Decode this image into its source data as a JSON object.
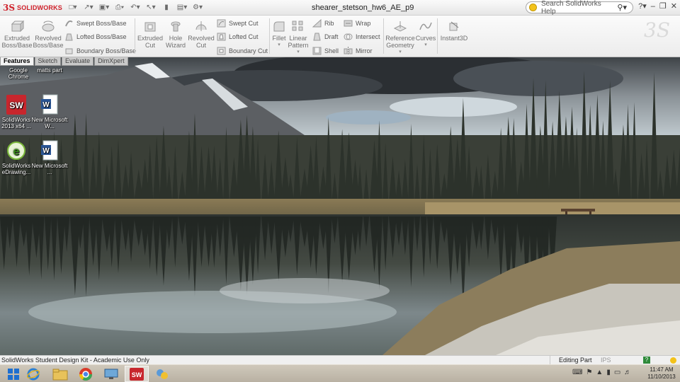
{
  "app": {
    "brand": "SOLIDWORKS",
    "document_title": "shearer_stetson_hw6_AE_p9"
  },
  "help_search": {
    "placeholder": "Search SolidWorks Help"
  },
  "toolbar": {
    "extruded_boss": "Extruded Boss/Base",
    "revolved_boss": "Revolved Boss/Base",
    "swept_boss": "Swept Boss/Base",
    "lofted_boss": "Lofted Boss/Base",
    "boundary_boss": "Boundary Boss/Base",
    "extruded_cut": "Extruded Cut",
    "hole_wizard": "Hole Wizard",
    "revolved_cut": "Revolved Cut",
    "swept_cut": "Swept Cut",
    "lofted_cut": "Lofted Cut",
    "boundary_cut": "Boundary Cut",
    "fillet": "Fillet",
    "linear_pattern": "Linear Pattern",
    "rib": "Rib",
    "draft": "Draft",
    "shell": "Shell",
    "wrap": "Wrap",
    "intersect": "Intersect",
    "mirror": "Mirror",
    "reference_geometry": "Reference Geometry",
    "curves": "Curves",
    "instant3d": "Instant3D"
  },
  "tabs": [
    "Features",
    "Sketch",
    "Evaluate",
    "DimXpert"
  ],
  "desktop_icons": [
    {
      "label": "Google Chrome"
    },
    {
      "label": "matts part"
    },
    {
      "label": "SolidWorks 2013 x64 ..."
    },
    {
      "label": "New Microsoft W..."
    },
    {
      "label": "SolidWorks eDrawing..."
    },
    {
      "label": "New Microsoft ..."
    }
  ],
  "status": {
    "left": "SolidWorks Student Design Kit - Academic Use Only",
    "mode": "Editing Part",
    "units": "IPS"
  },
  "clock": {
    "time": "11:47 AM",
    "date": "11/10/2013"
  },
  "colors": {
    "brand_red": "#d0202a",
    "taskbar": "#c4bcaf",
    "ribbon": "#f2f2f2"
  }
}
